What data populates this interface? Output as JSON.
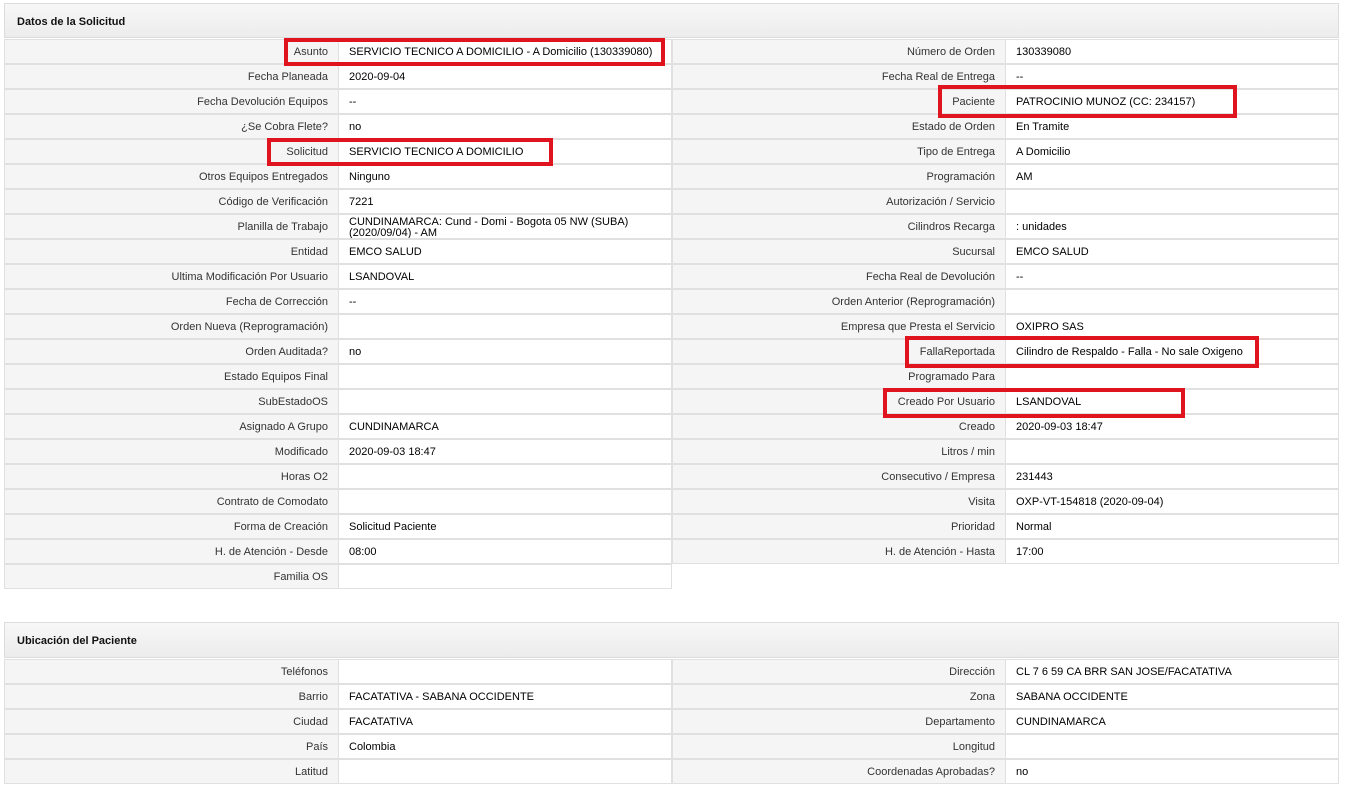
{
  "section1": {
    "title": "Datos de la Solicitud",
    "left": [
      {
        "label": "Asunto",
        "value": "SERVICIO TECNICO A DOMICILIO - A Domicilio (130339080)"
      },
      {
        "label": "Fecha Planeada",
        "value": "2020-09-04"
      },
      {
        "label": "Fecha Devolución Equipos",
        "value": "--"
      },
      {
        "label": "¿Se Cobra Flete?",
        "value": "no"
      },
      {
        "label": "Solicitud",
        "value": "SERVICIO TECNICO A DOMICILIO"
      },
      {
        "label": "Otros Equipos Entregados",
        "value": "Ninguno"
      },
      {
        "label": "Código de Verificación",
        "value": "7221"
      },
      {
        "label": "Planilla de Trabajo",
        "value": "CUNDINAMARCA: Cund - Domi - Bogota 05 NW (SUBA) (2020/09/04) - AM"
      },
      {
        "label": "Entidad",
        "value": "EMCO SALUD"
      },
      {
        "label": "Ultima Modificación Por Usuario",
        "value": "LSANDOVAL"
      },
      {
        "label": "Fecha de Corrección",
        "value": "--"
      },
      {
        "label": "Orden Nueva (Reprogramación)",
        "value": ""
      },
      {
        "label": "Orden Auditada?",
        "value": "no"
      },
      {
        "label": "Estado Equipos Final",
        "value": ""
      },
      {
        "label": "SubEstadoOS",
        "value": ""
      },
      {
        "label": "Asignado A Grupo",
        "value": "CUNDINAMARCA"
      },
      {
        "label": "Modificado",
        "value": "2020-09-03 18:47"
      },
      {
        "label": "Horas O2",
        "value": ""
      },
      {
        "label": "Contrato de Comodato",
        "value": ""
      },
      {
        "label": "Forma de Creación",
        "value": "Solicitud Paciente"
      },
      {
        "label": "H. de Atención - Desde",
        "value": "08:00"
      },
      {
        "label": "Familia OS",
        "value": ""
      }
    ],
    "right": [
      {
        "label": "Número de Orden",
        "value": "130339080"
      },
      {
        "label": "Fecha Real de Entrega",
        "value": "--"
      },
      {
        "label": "Paciente",
        "value": "PATROCINIO MUNOZ (CC: 234157)"
      },
      {
        "label": "Estado de Orden",
        "value": "En Tramite"
      },
      {
        "label": "Tipo de Entrega",
        "value": "A Domicilio"
      },
      {
        "label": "Programación",
        "value": "AM"
      },
      {
        "label": "Autorización / Servicio",
        "value": ""
      },
      {
        "label": "Cilindros Recarga",
        "value": ": unidades"
      },
      {
        "label": "Sucursal",
        "value": "EMCO SALUD"
      },
      {
        "label": "Fecha Real de Devolución",
        "value": "--"
      },
      {
        "label": "Orden Anterior (Reprogramación)",
        "value": ""
      },
      {
        "label": "Empresa que Presta el Servicio",
        "value": "OXIPRO SAS"
      },
      {
        "label": "FallaReportada",
        "value": "Cilindro de Respaldo - Falla - No sale Oxigeno"
      },
      {
        "label": "Programado Para",
        "value": ""
      },
      {
        "label": "Creado Por Usuario",
        "value": "LSANDOVAL"
      },
      {
        "label": "Creado",
        "value": "2020-09-03 18:47"
      },
      {
        "label": "Litros / min",
        "value": ""
      },
      {
        "label": "Consecutivo / Empresa",
        "value": "231443"
      },
      {
        "label": "Visita",
        "value": "OXP-VT-154818 (2020-09-04)"
      },
      {
        "label": "Prioridad",
        "value": "Normal"
      },
      {
        "label": "H. de Atención - Hasta",
        "value": "17:00"
      }
    ]
  },
  "section2": {
    "title": "Ubicación del Paciente",
    "left": [
      {
        "label": "Teléfonos",
        "value": ""
      },
      {
        "label": "Barrio",
        "value": "FACATATIVA - SABANA OCCIDENTE"
      },
      {
        "label": "Ciudad",
        "value": "FACATATIVA"
      },
      {
        "label": "País",
        "value": "Colombia"
      },
      {
        "label": "Latitud",
        "value": ""
      }
    ],
    "right": [
      {
        "label": "Dirección",
        "value": "CL 7 6 59 CA BRR SAN JOSE/FACATATIVA"
      },
      {
        "label": "Zona",
        "value": "SABANA OCCIDENTE"
      },
      {
        "label": "Departamento",
        "value": "CUNDINAMARCA"
      },
      {
        "label": "Longitud",
        "value": ""
      },
      {
        "label": "Coordenadas Aprobadas?",
        "value": "no"
      }
    ]
  },
  "colors": {
    "highlight": "#e0141e",
    "label_bg": "#f5f5f5",
    "border": "#e0e0e0"
  }
}
